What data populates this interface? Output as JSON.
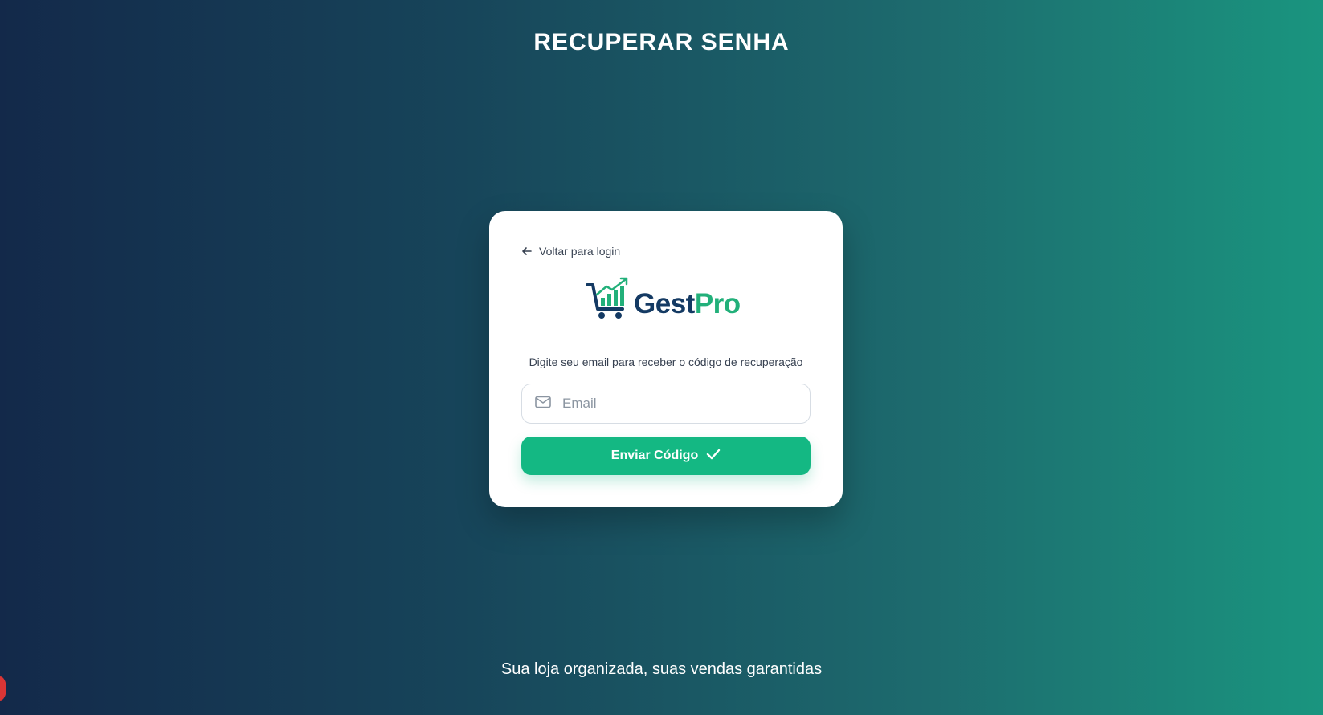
{
  "page": {
    "title": "RECUPERAR SENHA",
    "tagline": "Sua loja organizada, suas vendas garantidas"
  },
  "card": {
    "back_link_label": "Voltar para login",
    "logo": {
      "part1": "Gest",
      "part2": "Pro",
      "colors": {
        "primary": "#143a63",
        "accent": "#22b07a"
      }
    },
    "instruction": "Digite seu email para receber o código de recuperação",
    "email_field": {
      "placeholder": "Email",
      "value": "",
      "icon": "mail-icon"
    },
    "submit_button": {
      "label": "Enviar Código",
      "icon": "check-icon",
      "color": "#14b883"
    }
  },
  "theme": {
    "background_gradient": [
      "#13294a",
      "#1a957f"
    ]
  }
}
